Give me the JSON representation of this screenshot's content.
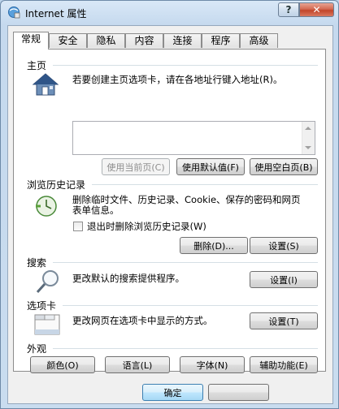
{
  "window": {
    "title": "Internet 属性",
    "help_glyph": "?",
    "close_glyph": "✕"
  },
  "tabs": [
    "常规",
    "安全",
    "隐私",
    "内容",
    "连接",
    "程序",
    "高级"
  ],
  "home": {
    "title": "主页",
    "description": "若要创建主页选项卡，请在各地址行键入地址(R)。",
    "address_value": "",
    "buttons": [
      "使用当前页(C)",
      "使用默认值(F)",
      "使用空白页(B)"
    ]
  },
  "history": {
    "title": "浏览历史记录",
    "description_line1": "删除临时文件、历史记录、Cookie、保存的密码和网页",
    "description_line2": "表单信息。",
    "checkbox_label": "退出时删除浏览历史记录(W)",
    "checkbox_checked": false,
    "delete_button": "删除(D)...",
    "settings_button": "设置(S)"
  },
  "search": {
    "title": "搜索",
    "description": "更改默认的搜索提供程序。",
    "settings_button": "设置(I)"
  },
  "tabs_section": {
    "title": "选项卡",
    "description": "更改网页在选项卡中显示的方式。",
    "settings_button": "设置(T)"
  },
  "appearance": {
    "title": "外观",
    "buttons": [
      "颜色(O)",
      "语言(L)",
      "字体(N)",
      "辅助功能(E)"
    ]
  },
  "footer": {
    "ok_button": "确定",
    "cancel_button": ""
  },
  "colors": {
    "accent": "#3c7fb1",
    "close": "#c2452a"
  }
}
